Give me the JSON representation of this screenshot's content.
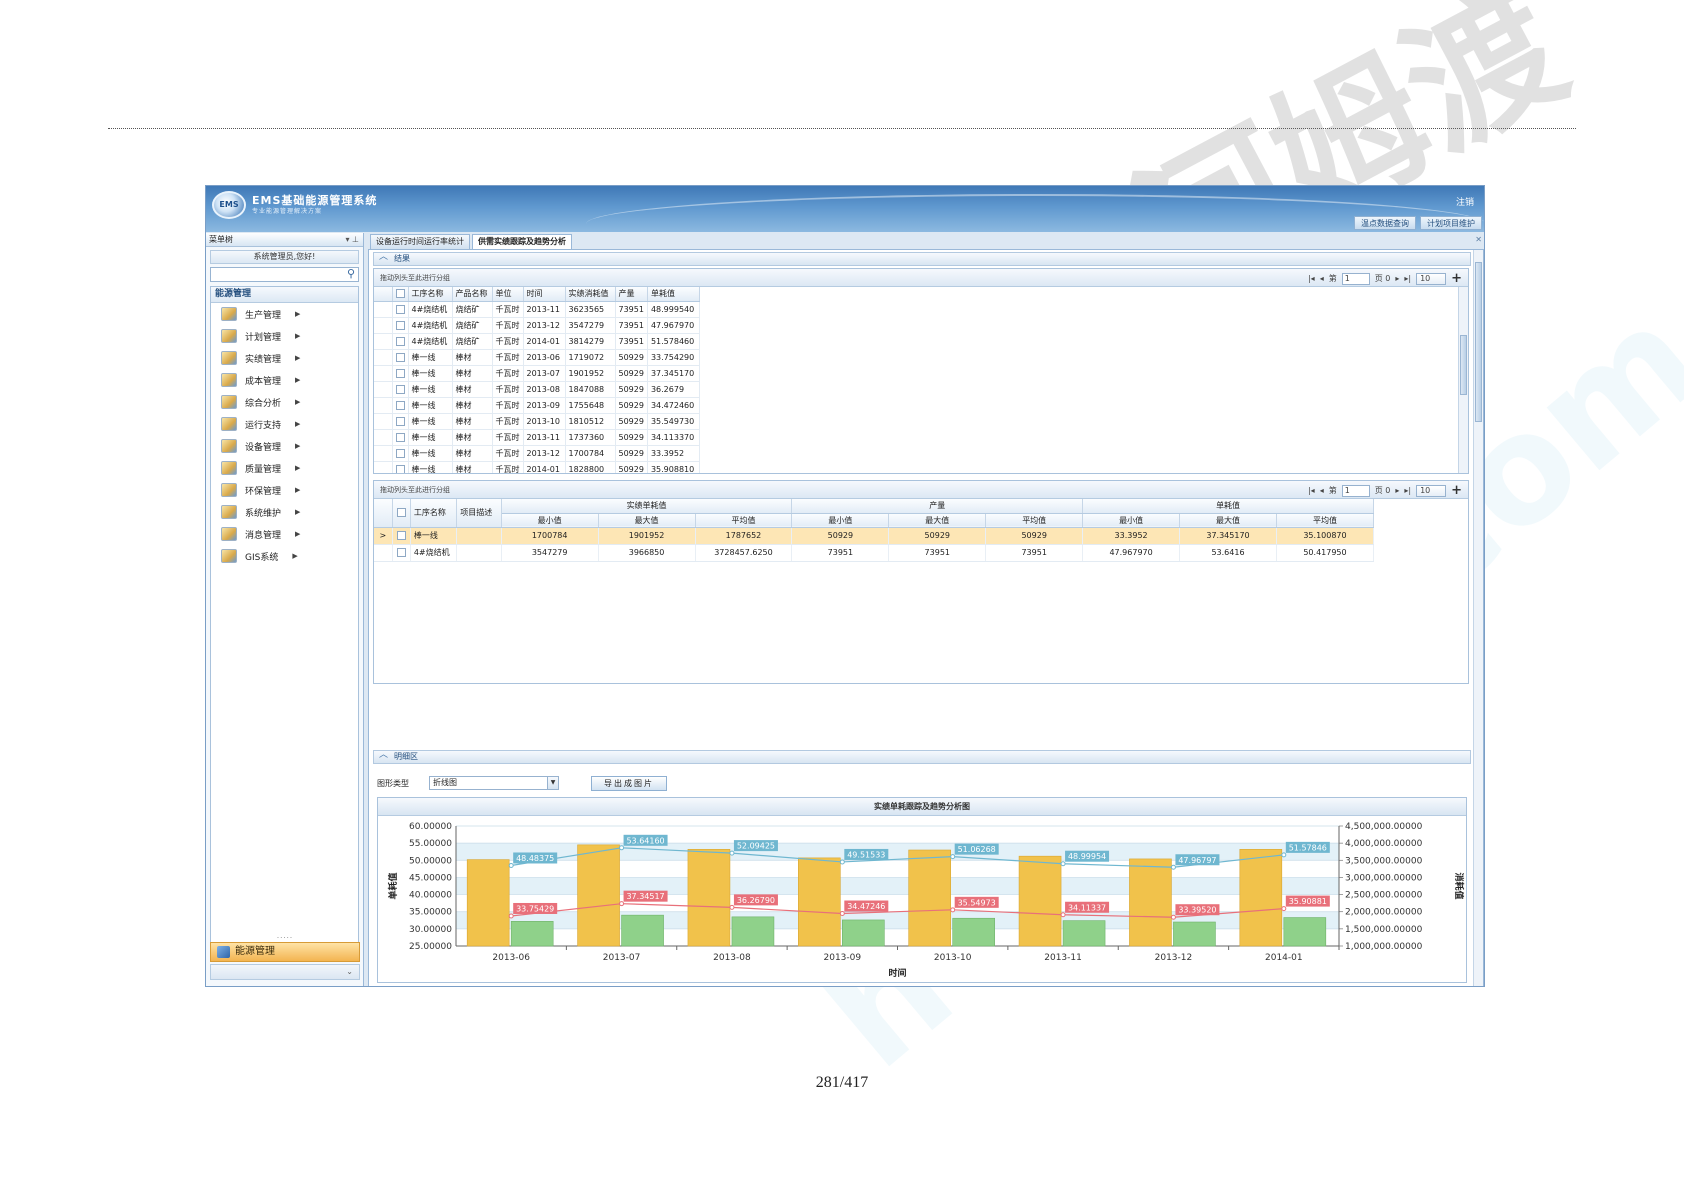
{
  "page_number": "281/417",
  "header": {
    "title": "EMS基础能源管理系统",
    "subtitle": "专业能源管理解决方案",
    "logo_text": "EMS",
    "logout": "注销",
    "buttons": [
      "温点数据查询",
      "计划项目维护"
    ]
  },
  "sidebar": {
    "menu_tree_label": "菜单树",
    "welcome": "系统管理员,您好!",
    "search_placeholder": "",
    "section_title": "能源管理",
    "items": [
      {
        "label": "生产管理"
      },
      {
        "label": "计划管理"
      },
      {
        "label": "实绩管理"
      },
      {
        "label": "成本管理"
      },
      {
        "label": "综合分析"
      },
      {
        "label": "运行支持"
      },
      {
        "label": "设备管理"
      },
      {
        "label": "质量管理"
      },
      {
        "label": "环保管理"
      },
      {
        "label": "系统维护"
      },
      {
        "label": "消息管理"
      },
      {
        "label": "GIS系统"
      }
    ],
    "bottom_label": "能源管理",
    "colors": {
      "active": "#f3b451"
    }
  },
  "tabs": [
    {
      "label": "设备运行时间运行率统计",
      "active": false
    },
    {
      "label": "供需实绩跟踪及趋势分析",
      "active": true
    }
  ],
  "result_section": {
    "title": "结果",
    "grid1": {
      "hint": "拖动列头至此进行分组",
      "pager": {
        "page_label": "第",
        "page_value": "1",
        "of_label": "页 0",
        "page_size": "10"
      },
      "columns": [
        "工序名称",
        "产品名称",
        "单位",
        "时间",
        "实绩消耗值",
        "产量",
        "单耗值"
      ],
      "rows": [
        [
          "4#烧结机",
          "烧结矿",
          "千瓦时",
          "2013-11",
          "3623565",
          "73951",
          "48.999540"
        ],
        [
          "4#烧结机",
          "烧结矿",
          "千瓦时",
          "2013-12",
          "3547279",
          "73951",
          "47.967970"
        ],
        [
          "4#烧结机",
          "烧结矿",
          "千瓦时",
          "2014-01",
          "3814279",
          "73951",
          "51.578460"
        ],
        [
          "棒一线",
          "棒材",
          "千瓦时",
          "2013-06",
          "1719072",
          "50929",
          "33.754290"
        ],
        [
          "棒一线",
          "棒材",
          "千瓦时",
          "2013-07",
          "1901952",
          "50929",
          "37.345170"
        ],
        [
          "棒一线",
          "棒材",
          "千瓦时",
          "2013-08",
          "1847088",
          "50929",
          "36.2679"
        ],
        [
          "棒一线",
          "棒材",
          "千瓦时",
          "2013-09",
          "1755648",
          "50929",
          "34.472460"
        ],
        [
          "棒一线",
          "棒材",
          "千瓦时",
          "2013-10",
          "1810512",
          "50929",
          "35.549730"
        ],
        [
          "棒一线",
          "棒材",
          "千瓦时",
          "2013-11",
          "1737360",
          "50929",
          "34.113370"
        ],
        [
          "棒一线",
          "棒材",
          "千瓦时",
          "2013-12",
          "1700784",
          "50929",
          "33.3952"
        ],
        [
          "棒一线",
          "棒材",
          "千瓦时",
          "2014-01",
          "1828800",
          "50929",
          "35.908810"
        ]
      ]
    },
    "grid2": {
      "hint": "拖动列头至此进行分组",
      "pager": {
        "page_label": "第",
        "page_value": "1",
        "of_label": "页 0",
        "page_size": "10"
      },
      "col_name": "工序名称",
      "col_desc": "项目描述",
      "groups": [
        "实绩单耗值",
        "产量",
        "单耗值"
      ],
      "subcols": [
        "最小值",
        "最大值",
        "平均值"
      ],
      "rows": [
        {
          "name": "棒一线",
          "desc": "",
          "values": [
            "1700784",
            "1901952",
            "1787652",
            "50929",
            "50929",
            "50929",
            "33.3952",
            "37.345170",
            "35.100870"
          ],
          "selected": true
        },
        {
          "name": "4#烧结机",
          "desc": "",
          "values": [
            "3547279",
            "3966850",
            "3728457.6250",
            "73951",
            "73951",
            "73951",
            "47.967970",
            "53.6416",
            "50.417950"
          ],
          "selected": false
        }
      ]
    }
  },
  "detail_section": {
    "title": "明细区",
    "chart_type_label": "图形类型",
    "chart_type_value": "折线图",
    "export_label": "导出成图片"
  },
  "chart_data": {
    "type": "bar",
    "title": "实绩单耗跟踪及趋势分析图",
    "xlabel": "时间",
    "ylabel": "单耗值",
    "y2label": "消耗值",
    "categories": [
      "2013-06",
      "2013-07",
      "2013-08",
      "2013-09",
      "2013-10",
      "2013-11",
      "2013-12",
      "2014-01"
    ],
    "ylim": [
      25,
      60
    ],
    "y_ticks": [
      "60.00000",
      "55.00000",
      "50.00000",
      "45.00000",
      "40.00000",
      "35.00000",
      "30.00000",
      "25.00000"
    ],
    "y2lim": [
      1000000,
      4500000
    ],
    "y2_ticks": [
      "4,500,000.00000",
      "4,000,000.00000",
      "3,500,000.00000",
      "3,000,000.00000",
      "2,500,000.00000",
      "2,000,000.00000",
      "1,500,000.00000",
      "1,000,000.00000"
    ],
    "bar_series": [
      {
        "axis": "y2",
        "color": "#f1c24b",
        "values": [
          3520000,
          3950000,
          3820000,
          3570000,
          3800000,
          3620000,
          3540000,
          3820000
        ]
      },
      {
        "axis": "y2",
        "color": "#8fd18a",
        "values": [
          1720000,
          1900000,
          1850000,
          1760000,
          1810000,
          1740000,
          1700000,
          1830000
        ]
      }
    ],
    "line_series": [
      {
        "axis": "y",
        "color": "#6fb7d0",
        "values": [
          48.48375,
          53.6416,
          52.09425,
          49.51533,
          51.06268,
          48.99954,
          47.96797,
          51.57846
        ],
        "labels": [
          "48.48375",
          "53.64160",
          "52.09425",
          "49.51533",
          "51.06268",
          "48.99954",
          "47.96797",
          "51.57846"
        ]
      },
      {
        "axis": "y",
        "color": "#e8707a",
        "values": [
          33.75429,
          37.34517,
          36.2679,
          34.47246,
          35.54973,
          34.11337,
          33.3952,
          35.90881
        ],
        "labels": [
          "33.75429",
          "37.34517",
          "36.26790",
          "34.47246",
          "35.54973",
          "34.11337",
          "33.39520",
          "35.90881"
        ]
      }
    ],
    "grid": true
  },
  "watermark": {
    "text1": "homedo.com",
    "text2": "河姆渡"
  }
}
